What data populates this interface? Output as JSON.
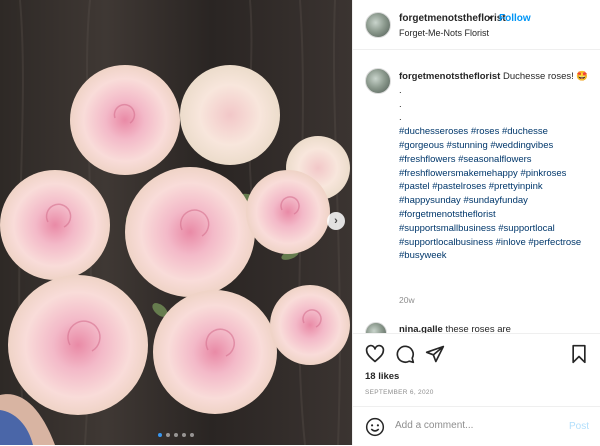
{
  "post": {
    "username": "forgetmenotstheflorist",
    "follow_separator": "•",
    "follow_label": "Follow",
    "subtitle": "Forget-Me-Nots Florist"
  },
  "caption": {
    "username": "forgetmenotstheflorist",
    "text": "Duchesse roses! 🤩",
    "spacer_lines": [
      ".",
      ".",
      "."
    ],
    "hashtags": "#duchesseroses #roses #duchesse #gorgeous #stunning #weddingvibes #freshflowers #seasonalflowers #freshflowersmakemehappy #pinkroses #pastel #pastelroses #prettyinpink #happysunday #sundayfunday #forgetmenotstheflorist #supportsmallbusiness #supportlocal #supportlocalbusiness #inlove #perfectrose #busyweek",
    "time": "20w"
  },
  "comment2": {
    "username": "nina.galle",
    "text": "these roses are"
  },
  "actions": {
    "likes": "18 likes",
    "date": "SEPTEMBER 6, 2020",
    "comment_placeholder": "Add a comment...",
    "post_label": "Post"
  },
  "carousel": {
    "slides": 5,
    "active": 1
  },
  "colors": {
    "accent": "#0095f6",
    "hashtag": "#00376b",
    "muted": "#8e8e8e"
  },
  "icons": [
    "heart-icon",
    "comment-icon",
    "share-icon",
    "bookmark-icon",
    "emoji-icon",
    "chevron-right-icon"
  ]
}
